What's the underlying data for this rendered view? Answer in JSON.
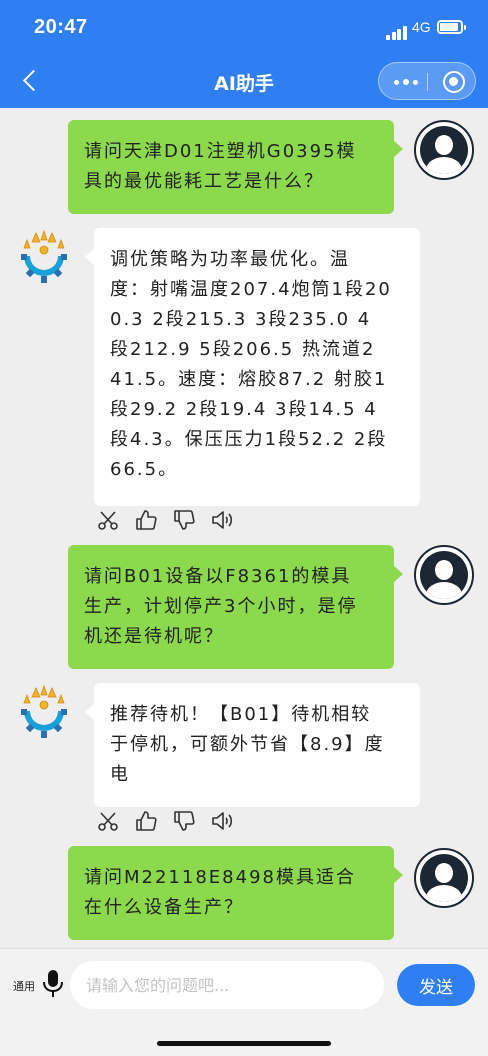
{
  "status_bar": {
    "time": "20:47",
    "network": "4G"
  },
  "nav": {
    "title": "AI助手"
  },
  "messages": [
    {
      "role": "user",
      "lines": [
        "请问天津D01注塑机G0395模",
        "具的最优能耗工艺是什么？"
      ]
    },
    {
      "role": "bot",
      "lines": [
        "调优策略为功率最优化。温",
        "度：射嘴温度207.4炮筒1段20",
        "0.3 2段215.3 3段235.0 4",
        "段212.9 5段206.5 热流道2",
        "41.5。速度：熔胶87.2 射胶1",
        "段29.2 2段19.4 3段14.5 4",
        "段4.3。保压压力1段52.2 2段",
        "66.5。"
      ]
    },
    {
      "role": "user",
      "lines": [
        "请问B01设备以F8361的模具",
        "生产，计划停产3个小时，是停",
        "机还是待机呢？"
      ]
    },
    {
      "role": "bot",
      "lines": [
        "推荐待机！【B01】待机相较",
        "于停机，可额外节省【8.9】度",
        "电"
      ]
    },
    {
      "role": "user",
      "lines": [
        "请问M22118E8498模具适合",
        "在什么设备生产？"
      ]
    }
  ],
  "message_actions": [
    "scissors-icon",
    "thumbs-up-icon",
    "thumbs-down-icon",
    "speaker-icon"
  ],
  "input_bar": {
    "mode_label": "通用",
    "placeholder": "请输入您的问题吧...",
    "send_label": "发送"
  },
  "colors": {
    "primary": "#2f7ff3",
    "user_bubble": "#8dd94d",
    "bot_bubble": "#ffffff",
    "background": "#eeeeee"
  }
}
